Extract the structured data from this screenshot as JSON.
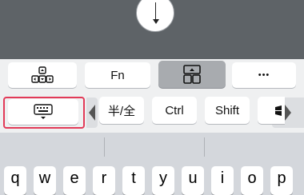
{
  "function_row1": {
    "fn_label": "Fn",
    "more_label": "•••"
  },
  "function_row2": {
    "hankaku_zenkaku_label": "半/全",
    "ctrl_label": "Ctrl",
    "shift_label": "Shift"
  },
  "letters": [
    "q",
    "w",
    "e",
    "r",
    "t",
    "y",
    "u",
    "i",
    "o",
    "p"
  ],
  "colors": {
    "highlight_outline": "#e23a58",
    "top_area": "#5e6367",
    "selected_key": "#a8abaf"
  },
  "icons": [
    "arrow-keys-icon",
    "window-layout-icon",
    "keyboard-icon",
    "windows-icon"
  ]
}
